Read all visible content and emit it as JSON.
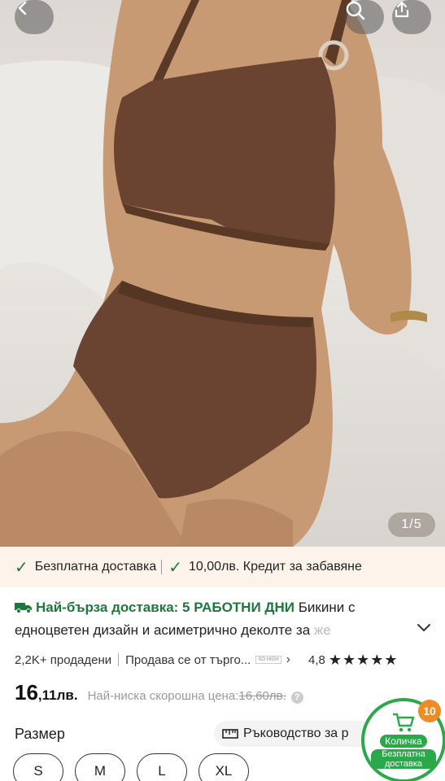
{
  "hero": {
    "image_counter": "1/5",
    "icons": [
      "back-icon",
      "search-icon",
      "share-icon"
    ]
  },
  "benefits": {
    "item1": "Безплатна доставка",
    "item2": "10,00лв. Кредит за забавяне"
  },
  "title": {
    "fast_delivery": "Най-бърза доставка: 5 РАБОТНИ ДНИ",
    "line1_rest": "Бикини с",
    "line2": "едноцветен дизайн и асиметрично деколте за ",
    "line2_fade": "же"
  },
  "stats": {
    "sold": "2,2K+ продадени",
    "seller": "Продава се от търго...",
    "seller_badge": "SO HIGH",
    "rating": "4,8",
    "stars": "★★★★★"
  },
  "price": {
    "main": "16",
    "cents": ",11лв.",
    "lowest_label": "Най-ниска скорошна цена:",
    "old": "16,60лв."
  },
  "size": {
    "label": "Размер",
    "guide": "Ръководство за р",
    "options": [
      "S",
      "M",
      "L",
      "XL"
    ]
  },
  "cart": {
    "badge": "10",
    "label": "Количка",
    "sub": "Безплатна доставка"
  },
  "colors": {
    "accent_green": "#1b7a3a",
    "benefits_bg": "#fdf3ea",
    "badge_orange": "#f08a24"
  }
}
